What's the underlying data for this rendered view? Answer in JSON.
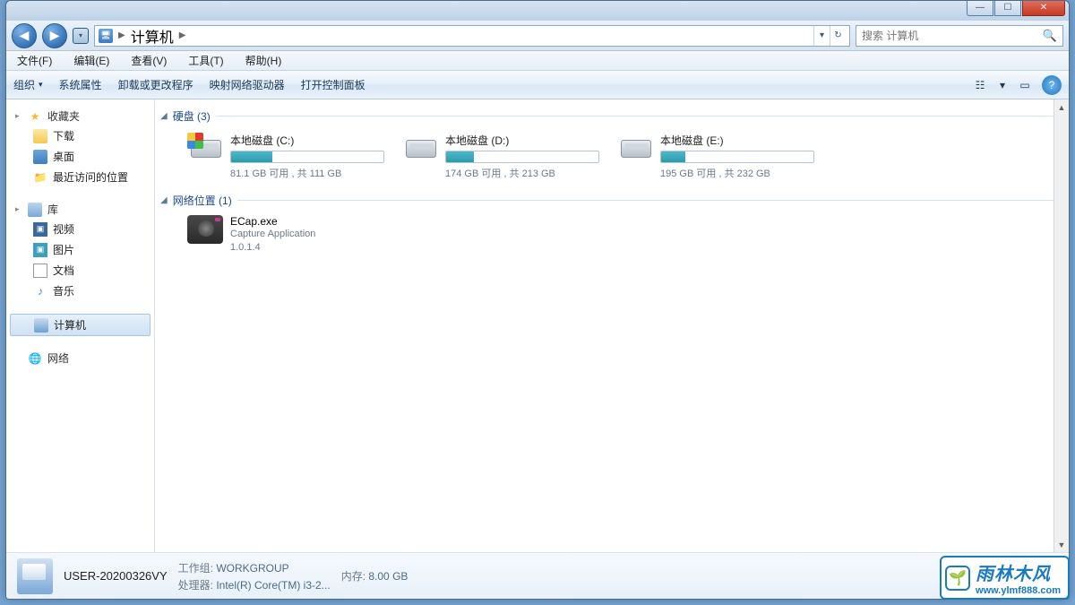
{
  "titlebar": {
    "min": "—",
    "max": "☐",
    "close": "✕"
  },
  "nav": {
    "back": "◀",
    "fwd": "▶",
    "down": "▾",
    "crumb": "计算机",
    "sep": "▶",
    "dd": "▾",
    "refresh": "↻"
  },
  "search": {
    "placeholder": "搜索 计算机",
    "icon": "🔍"
  },
  "menubar": {
    "file": "文件(F)",
    "edit": "编辑(E)",
    "view": "查看(V)",
    "tools": "工具(T)",
    "help": "帮助(H)"
  },
  "cmdbar": {
    "organize": "组织",
    "props": "系统属性",
    "uninstall": "卸载或更改程序",
    "mapdrive": "映射网络驱动器",
    "cpanel": "打开控制面板",
    "viewicon": "☷",
    "viewdd": "▾",
    "preview": "▭",
    "help": "?"
  },
  "sidebar": {
    "fav": "收藏夹",
    "downloads": "下载",
    "desktop": "桌面",
    "recent": "最近访问的位置",
    "libs": "库",
    "video": "视频",
    "pictures": "图片",
    "docs": "文档",
    "music": "音乐",
    "computer": "计算机",
    "network": "网络"
  },
  "groups": {
    "hdd": "硬盘 (3)",
    "net": "网络位置 (1)"
  },
  "drives": [
    {
      "name": "本地磁盘 (C:)",
      "stat": "81.1 GB 可用 , 共 111 GB",
      "fill": 27
    },
    {
      "name": "本地磁盘 (D:)",
      "stat": "174 GB 可用 , 共 213 GB",
      "fill": 18
    },
    {
      "name": "本地磁盘 (E:)",
      "stat": "195 GB 可用 , 共 232 GB",
      "fill": 16
    }
  ],
  "netapp": {
    "name": "ECap.exe",
    "desc": "Capture Application",
    "ver": "1.0.1.4"
  },
  "details": {
    "name": "USER-20200326VY",
    "wglabel": "工作组:",
    "wg": "WORKGROUP",
    "cpulabel": "处理器:",
    "cpu": "Intel(R) Core(TM) i3-2...",
    "memlabel": "内存:",
    "mem": "8.00 GB"
  },
  "watermark": {
    "brand": "雨林木风",
    "url": "www.ylmf888.com",
    "leaf": "🌱"
  }
}
